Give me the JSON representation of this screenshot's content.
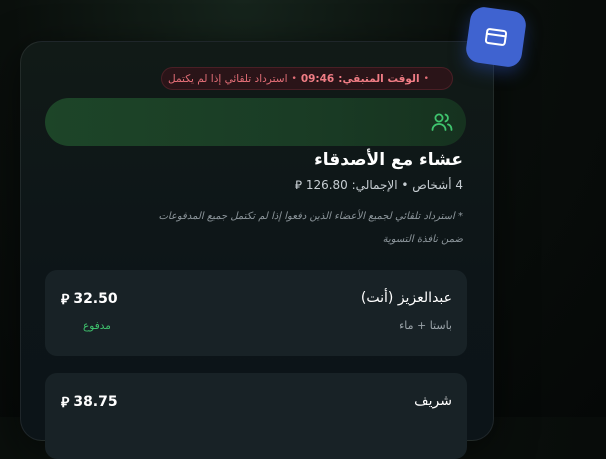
{
  "timer": {
    "label": "الوقت المتبقي:",
    "time": "09:46",
    "refund_note": "استرداد تلقائي إذا لم يكتمل"
  },
  "group": {
    "title": "عشاء مع الأصدقاء",
    "subtitle": "4 أشخاص • الإجمالي: 126.80 ⃁",
    "note": "* استرداد تلقائي لجميع الأعضاء الذين دفعوا إذا لم تكتمل جميع المدفوعات ضمن نافذة التسوية"
  },
  "members": [
    {
      "name": "عبدالعزيز (أنت)",
      "items": "باستا + ماء",
      "amount": "32.50",
      "status": "مدفوع"
    },
    {
      "name": "شريف",
      "items": "",
      "amount": "38.75",
      "status": ""
    }
  ],
  "currency_symbol": "⃁",
  "icons": {
    "fab": "card-icon",
    "banner": "users-icon"
  },
  "colors": {
    "accent": "#3f63d0",
    "danger": "#e36e77",
    "success": "#3fc46e",
    "banner": "#1d4528"
  }
}
